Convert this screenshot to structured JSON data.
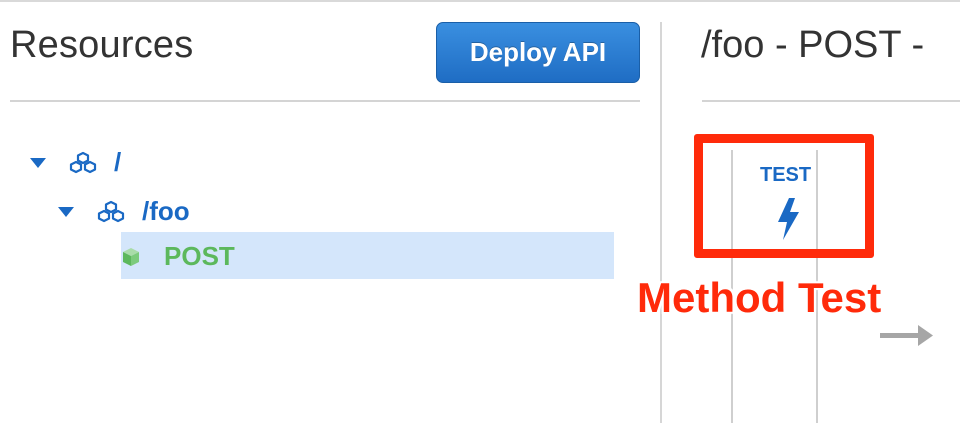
{
  "left_panel": {
    "title": "Resources",
    "deploy_button_label": "Deploy API",
    "tree": [
      {
        "label": "/",
        "icon": "resource-cubes-icon",
        "expanded": true
      },
      {
        "label": "/foo",
        "icon": "resource-cubes-icon",
        "expanded": true
      },
      {
        "label": "POST",
        "icon": "method-cube-icon",
        "selected": true
      }
    ]
  },
  "right_panel": {
    "title": "/foo - POST -",
    "test_label": "TEST",
    "test_icon": "lightning-bolt-icon",
    "annotation": "Method Test",
    "arrow_icon": "arrow-right-icon"
  },
  "colors": {
    "accent_blue": "#1a69c4",
    "method_green": "#5cb85c",
    "selection_bg": "#d4e6fb",
    "annotation_red": "#ff2a0a"
  }
}
